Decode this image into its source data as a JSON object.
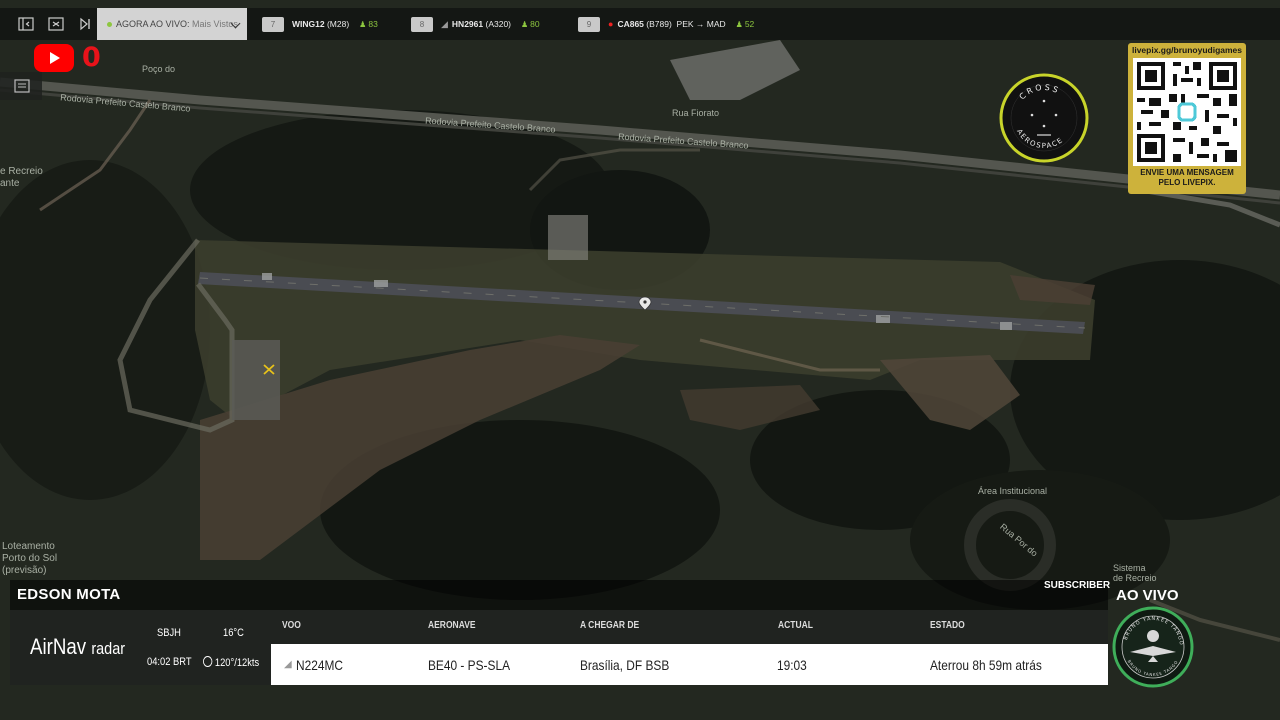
{
  "topbar": {
    "now_label": "AGORA AO VIVO:",
    "now_value": "Mais Vistos",
    "flights": [
      {
        "rank": "7",
        "flight": "WING12",
        "aircraft": "(M28)",
        "viewers": "83"
      },
      {
        "rank": "8",
        "flight": "HN2961",
        "aircraft": "(A320)",
        "viewers": "80"
      },
      {
        "rank": "9",
        "flight": "CA865",
        "aircraft": "(B789)",
        "route": "PEK → MAD",
        "viewers": "52"
      }
    ]
  },
  "overlay": {
    "notification_count": "0",
    "cross_logo_top": "CROSS",
    "cross_logo_bottom": "AEROSPACE",
    "qr_url": "livepix.gg/brunoyudigames",
    "qr_message_line1": "ENVIE UMA MENSAGEM",
    "qr_message_line2": "PELO LIVEPIX.",
    "live_badge": "AO VIVO",
    "tango_logo_top": "BRUNO YANKEE TANGO",
    "tango_logo_bottom": "BRUNO YANKEE TANGO"
  },
  "map": {
    "labels": [
      "Poço do",
      "Rodovia Prefeito Castelo Branco",
      "Rodovia Prefeito Castelo Branco",
      "Rodovia Prefeito Castelo Branco",
      "Rua Fiorato",
      "e Recreio",
      "ante",
      "Loteamento",
      "Porto do Sol",
      "(previsão)",
      "Área Institucional",
      "Rua Por do",
      "Sistema",
      "de Recreio"
    ]
  },
  "panel": {
    "pilot_name": "EDSON MOTA",
    "subscriber_label": "SUBSCRIBER",
    "brand": "AirNav",
    "brand_suffix": "radar",
    "airport_code": "SBJH",
    "local_time": "04:02 BRT",
    "temperature": "16°C",
    "wind": "120°/12kts",
    "columns": {
      "flight": "VOO",
      "aircraft": "AERONAVE",
      "origin": "A CHEGAR DE",
      "actual": "ACTUAL",
      "status": "ESTADO"
    },
    "row": {
      "flight": "N224MC",
      "aircraft": "BE40 - PS-SLA",
      "origin": "Brasília, DF BSB",
      "actual": "19:03",
      "status": "Aterrou 8h 59m atrás"
    }
  },
  "colors": {
    "accent_green": "#8dc63f",
    "live_red": "#e8131a",
    "qr_gold": "#cdb23b",
    "panel_dark": "#202320"
  }
}
